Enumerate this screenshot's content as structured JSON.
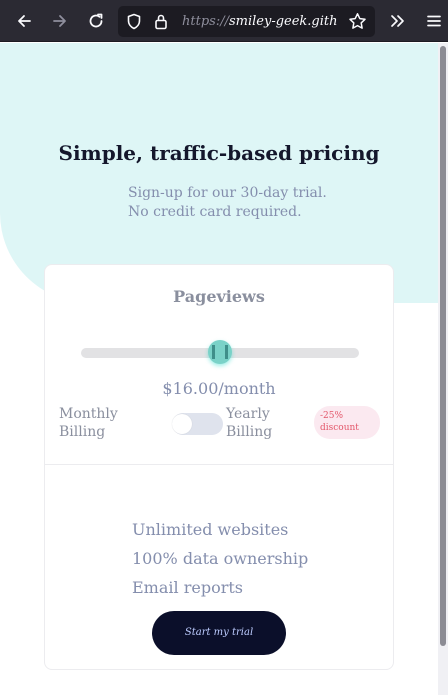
{
  "browser": {
    "url_scheme": "https://",
    "url_host": "smiley-geek.github.io"
  },
  "hero": {
    "title": "Simple, traffic-based pricing",
    "subtitle_line1": "Sign-up for our 30-day trial.",
    "subtitle_line2": "No credit card required."
  },
  "card": {
    "pageviews_label": "Pageviews",
    "slider_value": 0.5,
    "price": "$16.00/month",
    "monthly_line1": "Monthly",
    "monthly_line2": "Billing",
    "yearly_line1": "Yearly",
    "yearly_line2": "Billing",
    "toggle_on": false,
    "discount_line1": "-25%",
    "discount_line2": "discount",
    "features": [
      "Unlimited websites",
      "100% data ownership",
      "Email reports"
    ],
    "cta_label": "Start my trial"
  },
  "colors": {
    "hero_bg": "#def6f6",
    "slider_thumb": "#7ad2c8",
    "cta_bg": "#0b0f2a",
    "discount_text": "#e3586b"
  },
  "icons": [
    "back-arrow-icon",
    "forward-arrow-icon",
    "reload-icon",
    "shield-icon",
    "lock-icon",
    "star-icon",
    "overflow-chevrons-icon",
    "menu-icon"
  ]
}
